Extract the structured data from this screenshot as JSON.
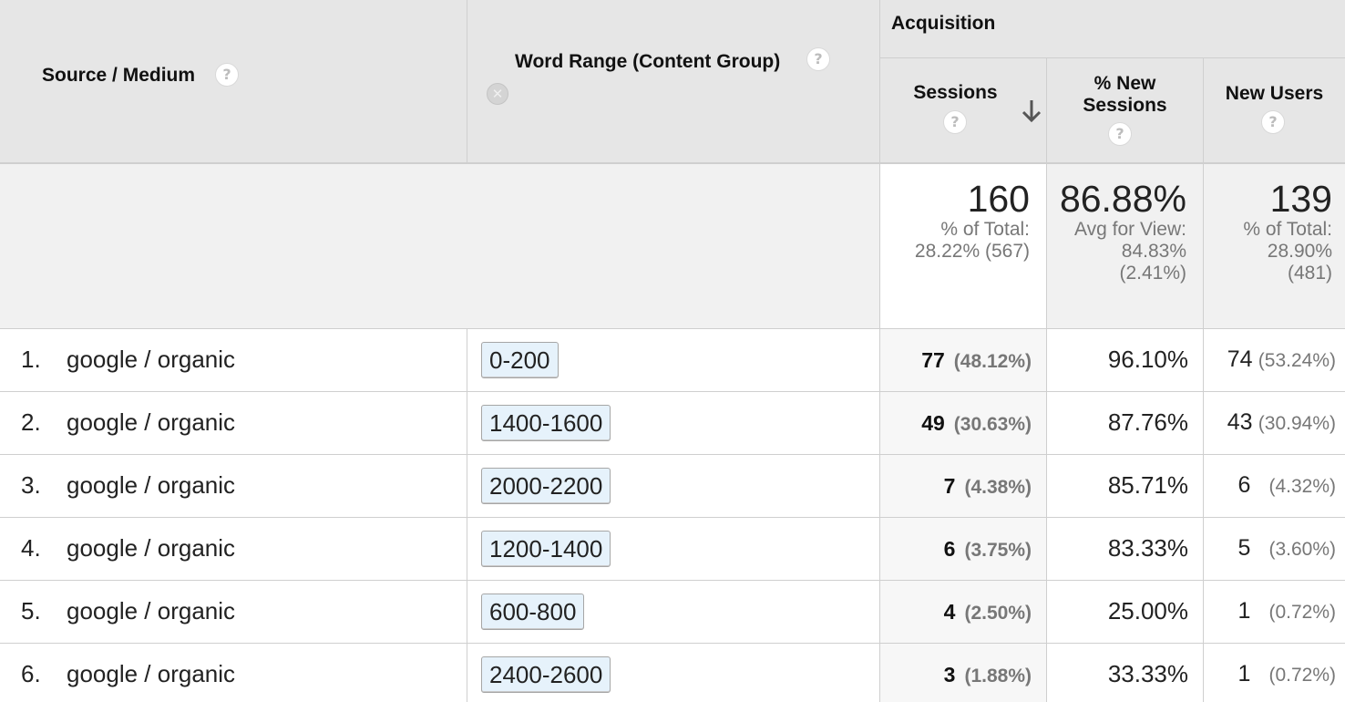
{
  "headers": {
    "source_medium": "Source / Medium",
    "word_range": "Word Range (Content Group)",
    "acquisition": "Acquisition",
    "sessions": "Sessions",
    "pct_new_sessions_line1": "% New",
    "pct_new_sessions_line2": "Sessions",
    "new_users": "New Users",
    "help_glyph": "?"
  },
  "totals": {
    "sessions": {
      "value": "160",
      "line1": "% of Total:",
      "line2": "28.22% (567)"
    },
    "pct_new_sessions": {
      "value": "86.88%",
      "line1": "Avg for View:",
      "line2": "84.83%",
      "line3": "(2.41%)"
    },
    "new_users": {
      "value": "139",
      "line1": "% of Total:",
      "line2": "28.90%",
      "line3": "(481)"
    }
  },
  "rows": [
    {
      "num": "1.",
      "source": "google / organic",
      "word_range": "0-200",
      "sessions": "77",
      "sessions_pct": "(48.12%)",
      "pct_new": "96.10%",
      "new_users": "74",
      "new_users_pct": "(53.24%)"
    },
    {
      "num": "2.",
      "source": "google / organic",
      "word_range": "1400-1600",
      "sessions": "49",
      "sessions_pct": "(30.63%)",
      "pct_new": "87.76%",
      "new_users": "43",
      "new_users_pct": "(30.94%)"
    },
    {
      "num": "3.",
      "source": "google / organic",
      "word_range": "2000-2200",
      "sessions": "7",
      "sessions_pct": "(4.38%)",
      "pct_new": "85.71%",
      "new_users": "6",
      "new_users_pct": "(4.32%)"
    },
    {
      "num": "4.",
      "source": "google / organic",
      "word_range": "1200-1400",
      "sessions": "6",
      "sessions_pct": "(3.75%)",
      "pct_new": "83.33%",
      "new_users": "5",
      "new_users_pct": "(3.60%)"
    },
    {
      "num": "5.",
      "source": "google / organic",
      "word_range": "600-800",
      "sessions": "4",
      "sessions_pct": "(2.50%)",
      "pct_new": "25.00%",
      "new_users": "1",
      "new_users_pct": "(0.72%)"
    },
    {
      "num": "6.",
      "source": "google / organic",
      "word_range": "2400-2600",
      "sessions": "3",
      "sessions_pct": "(1.88%)",
      "pct_new": "33.33%",
      "new_users": "1",
      "new_users_pct": "(0.72%)"
    }
  ],
  "icons": {
    "help": "help-icon",
    "remove_dimension": "remove-dimension-icon",
    "sort_descending": "sort-descending-icon"
  },
  "colors": {
    "header_bg": "#e6e6e6",
    "tag_bg": "#e6f2fb",
    "muted_text": "#777777"
  }
}
